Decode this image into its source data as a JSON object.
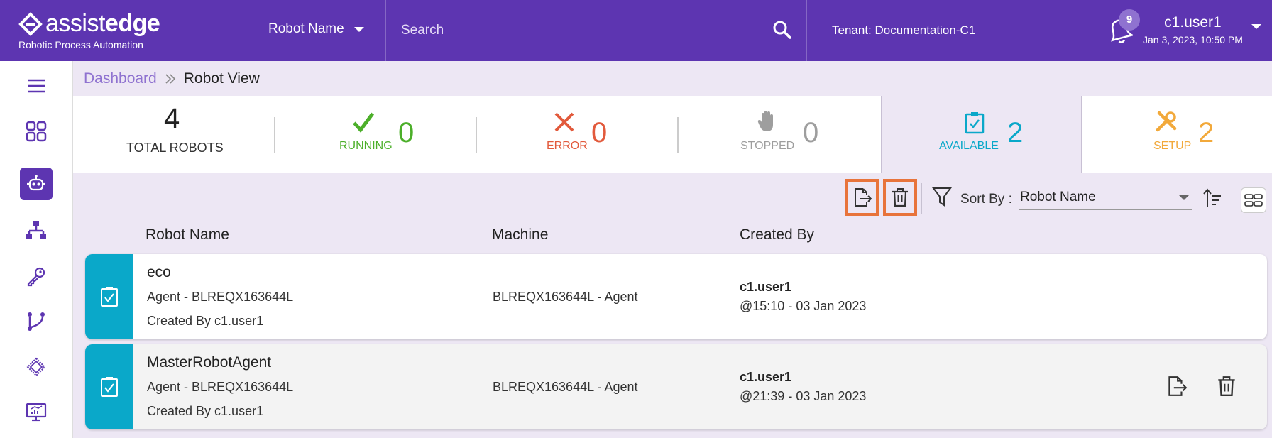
{
  "header": {
    "brand_light": "assist",
    "brand_bold": "edge",
    "brand_sub": "Robotic Process Automation",
    "robot_select": "Robot Name",
    "search_placeholder": "Search",
    "tenant_label": "Tenant:",
    "tenant_value": "Documentation-C1",
    "notification_count": "9",
    "user_name": "c1.user1",
    "user_datetime": "Jan 3, 2023, 10:50 PM"
  },
  "sidebar": {
    "items": [
      {
        "icon": "menu-icon"
      },
      {
        "icon": "dashboard-grid-icon"
      },
      {
        "icon": "robot-icon",
        "active": true
      },
      {
        "icon": "hierarchy-icon"
      },
      {
        "icon": "key-icon"
      },
      {
        "icon": "workflow-icon"
      },
      {
        "icon": "chip-icon"
      },
      {
        "icon": "monitor-chart-icon"
      }
    ]
  },
  "breadcrumb": {
    "parent": "Dashboard",
    "current": "Robot View"
  },
  "stats": {
    "total": {
      "value": "4",
      "label": "TOTAL ROBOTS"
    },
    "running": {
      "value": "0",
      "label": "RUNNING",
      "color": "#4caf2a"
    },
    "error": {
      "value": "0",
      "label": "ERROR",
      "color": "#e25a3c"
    },
    "stopped": {
      "value": "0",
      "label": "STOPPED",
      "color": "#9e9e9e"
    },
    "available": {
      "value": "2",
      "label": "AVAILABLE",
      "color": "#0aa8c9"
    },
    "setup": {
      "value": "2",
      "label": "SETUP",
      "color": "#f2a93b"
    }
  },
  "toolbar": {
    "sort_label": "Sort By :",
    "sort_value": "Robot Name"
  },
  "table": {
    "columns": [
      "Robot Name",
      "Machine",
      "Created By"
    ],
    "rows": [
      {
        "name": "eco",
        "agent": "Agent - BLREQX163644L",
        "created_by": "Created By c1.user1",
        "machine": "BLREQX163644L - Agent",
        "user": "c1.user1",
        "time": "@15:10 - 03 Jan 2023"
      },
      {
        "name": "MasterRobotAgent",
        "agent": "Agent - BLREQX163644L",
        "created_by": "Created By c1.user1",
        "machine": "BLREQX163644L - Agent",
        "user": "c1.user1",
        "time": "@21:39 - 03 Jan 2023"
      }
    ]
  },
  "colors": {
    "header": "#5d35b1",
    "accent": "#0aa8c9",
    "highlight": "#e8743b"
  }
}
